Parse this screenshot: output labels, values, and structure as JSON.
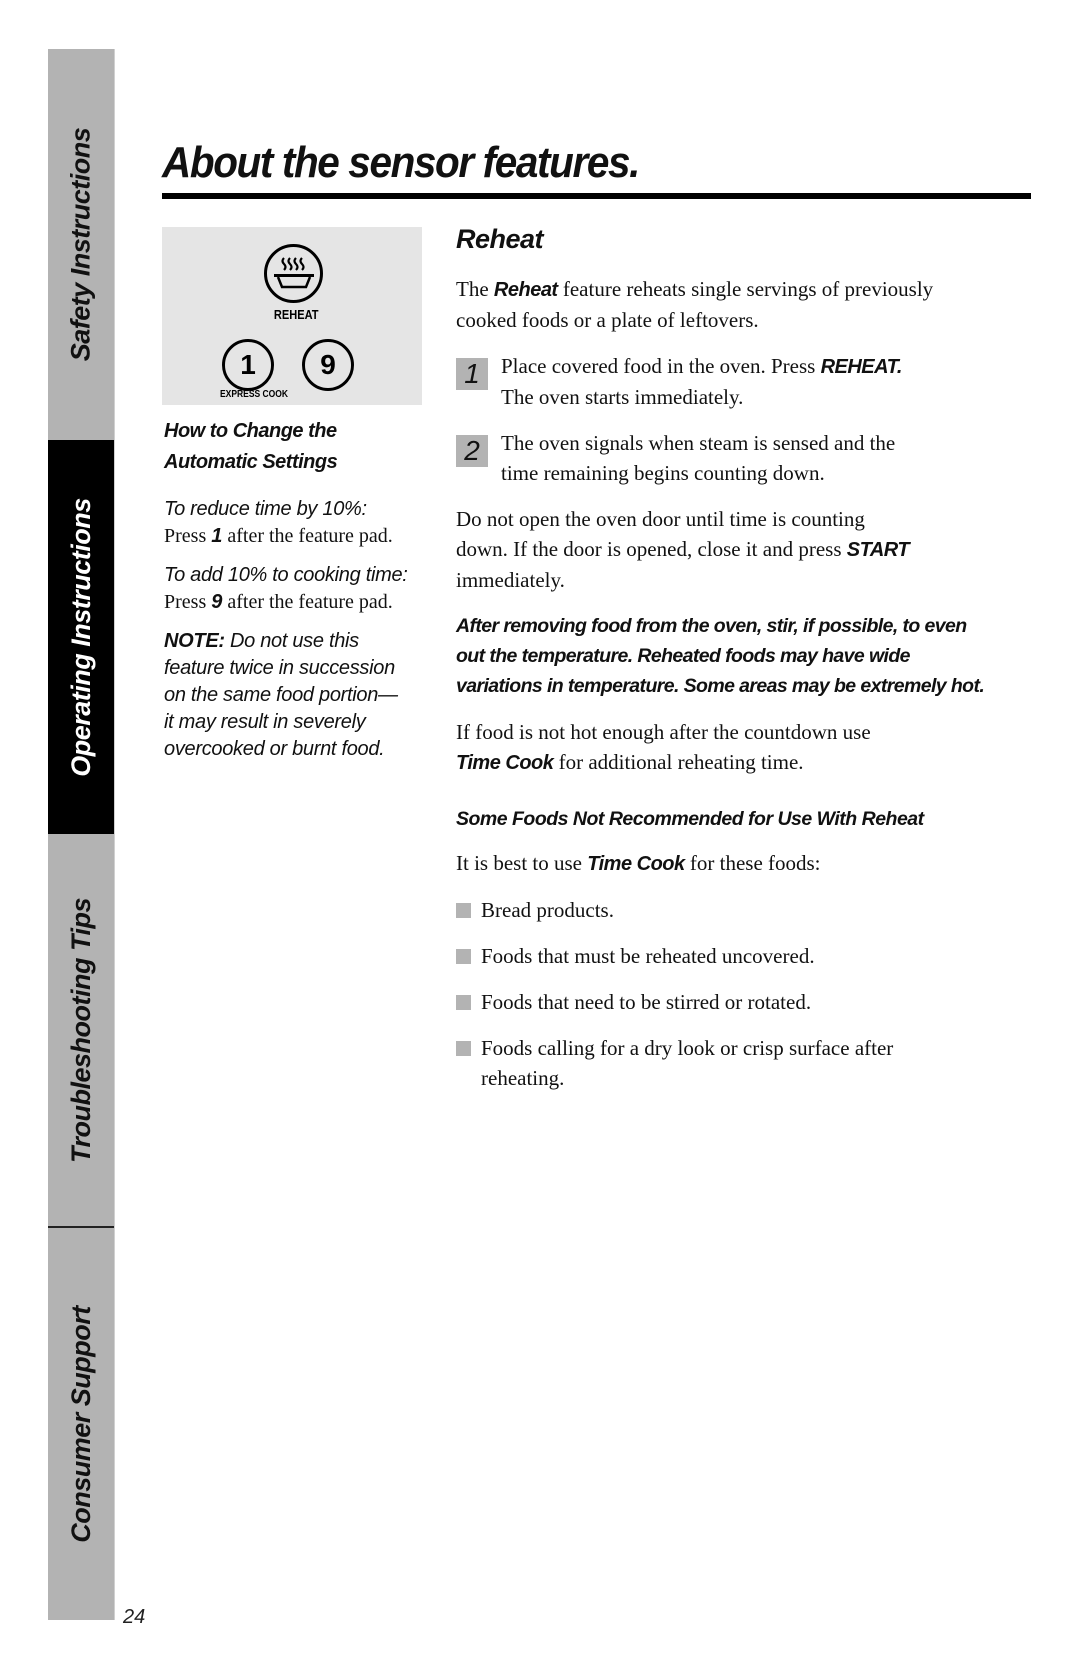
{
  "sidebar": {
    "tabs": [
      {
        "label": "Safety Instructions",
        "active": false
      },
      {
        "label": "Operating Instructions",
        "active": true
      },
      {
        "label": "Troubleshooting Tips",
        "active": false
      },
      {
        "label": "Consumer Support",
        "active": false
      }
    ]
  },
  "page_number": "24",
  "title": "About the sensor features.",
  "control_panel": {
    "reheat_icon": "steaming-dish-icon",
    "reheat_label": "REHEAT",
    "pad_1": "1",
    "pad_9": "9",
    "express_cook_label": "EXPRESS COOK"
  },
  "left": {
    "heading_line1": "How to Change the",
    "heading_line2": "Automatic Settings",
    "reduce_heading": "To reduce time by 10%:",
    "reduce_press": "Press ",
    "reduce_key": "1",
    "reduce_rest": " after the feature pad.",
    "add_heading": "To add 10% to cooking time:",
    "add_press": "Press ",
    "add_key": "9",
    "add_rest": " after the feature pad.",
    "note_label": "NOTE:",
    "note_lines": [
      " Do not use this",
      "feature twice in succession",
      "on the same food portion—",
      "it may result in severely",
      "overcooked or burnt food."
    ]
  },
  "right": {
    "section_title": "Reheat",
    "intro_pre": "The ",
    "intro_em": "Reheat",
    "intro_post_line1": "  feature reheats single servings of previously",
    "intro_line2": "cooked foods or a plate of leftovers.",
    "steps": [
      {
        "num": "1",
        "line1_pre": "Place covered food in the oven. Press ",
        "line1_em": "REHEAT.",
        "line2": "The oven starts immediately."
      },
      {
        "num": "2",
        "line1_pre": "The oven signals when steam is sensed and the",
        "line1_em": "",
        "line2": "time remaining begins counting down."
      }
    ],
    "door_line1": "Do not open the oven door until time is counting",
    "door_line2_pre": "down. If the door is opened, close it and press ",
    "door_line2_em": "START",
    "door_line3": "immediately.",
    "warning_lines": [
      "After removing food from the oven, stir, if possible, to even",
      "out the temperature. Reheated foods may have wide",
      "variations in temperature. Some areas may be extremely hot."
    ],
    "notHot_line1": "If food is not hot enough after the countdown use",
    "notHot_em": "Time Cook",
    "notHot_rest": " for additional reheating time.",
    "not_recommended_heading": "Some Foods Not Recommended for Use With Reheat",
    "best_pre": "It is best to use ",
    "best_em": "Time Cook",
    "best_post": " for these foods:",
    "foods": [
      "Bread products.",
      "Foods that must be reheated uncovered.",
      "Foods that need to be stirred or rotated.",
      "Foods calling for a dry look or crisp surface after reheating."
    ]
  }
}
